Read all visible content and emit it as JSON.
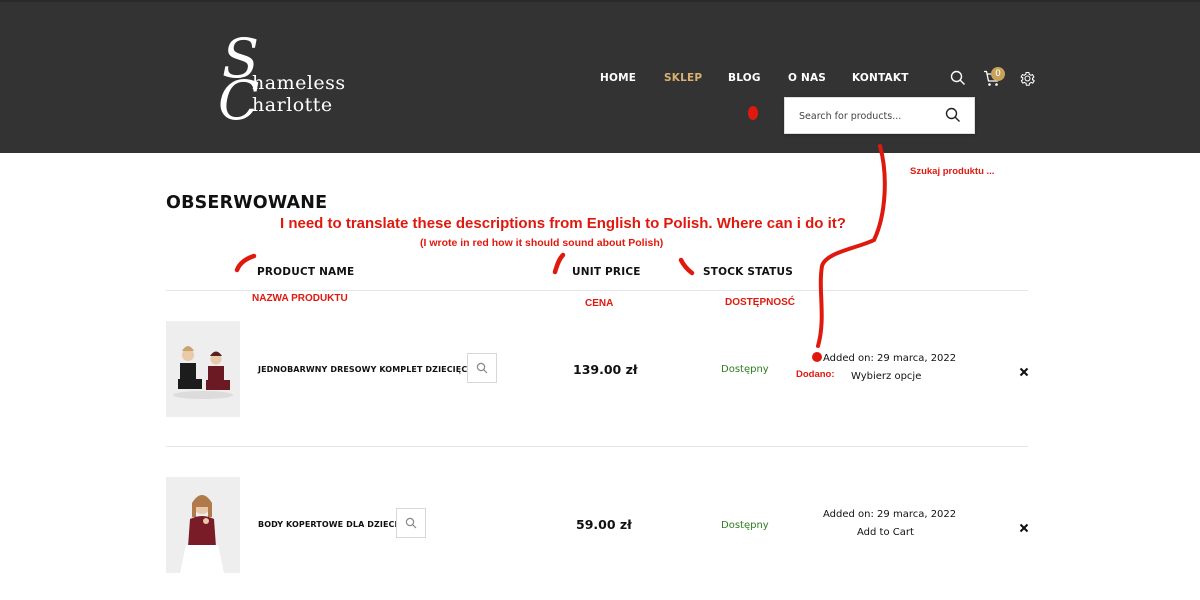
{
  "logo": {
    "initial_s": "S",
    "word_1": "hameless",
    "initial_c": "C",
    "word_2": "harlotte"
  },
  "nav": {
    "items": [
      {
        "label": "HOME"
      },
      {
        "label": "SKLEP"
      },
      {
        "label": "BLOG"
      },
      {
        "label": "O NAS"
      },
      {
        "label": "KONTAKT"
      }
    ],
    "cart_count": "0",
    "icons": [
      "search-icon",
      "cart-icon",
      "gear-icon"
    ]
  },
  "search": {
    "placeholder": "Search for products..."
  },
  "page": {
    "title": "OBSERWOWANE"
  },
  "table": {
    "headers": {
      "product_name": "PRODUCT NAME",
      "unit_price": "UNIT PRICE",
      "stock_status": "STOCK STATUS"
    },
    "rows": [
      {
        "name": "JEDNOBARWNY DRESOWY KOMPLET DZIECIĘCY",
        "price": "139.00 zł",
        "stock": "Dostępny",
        "added": "Added on: 29 marca, 2022",
        "action": "Wybierz opcje"
      },
      {
        "name": "BODY KOPERTOWE DLA DZIECI",
        "price": "59.00 zł",
        "stock": "Dostępny",
        "added": "Added on: 29 marca, 2022",
        "action": "Add to Cart"
      }
    ]
  },
  "annotations": {
    "question": "I need to translate these descriptions from English to Polish. Where can i do it?",
    "note": "(I wrote in red how it should sound about Polish)",
    "search_pl": "Szukaj produktu ...",
    "name_pl": "NAZWA PRODUKTU",
    "price_pl": "CENA",
    "stock_pl": "DOSTĘPNOSĆ",
    "added_pl": "Dodano:",
    "color": "#e0190f"
  },
  "colors": {
    "header_bg": "#333333",
    "accent": "#d8b071",
    "in_stock": "#2e7d1e",
    "annotation": "#e0190f"
  }
}
